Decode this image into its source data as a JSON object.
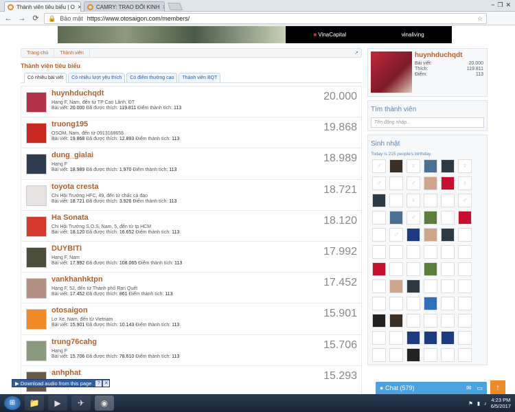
{
  "browser": {
    "tabs": [
      {
        "title": "Thành viên tiêu biểu | O",
        "active": true
      },
      {
        "title": "CAMRY: TRAO ĐỔI KINH",
        "active": false
      }
    ],
    "nav": {
      "back": "←",
      "forward": "→",
      "reload": "⟳"
    },
    "address": {
      "secure_label": "Bảo mật",
      "url": "https://www.otosaigon.com/members/",
      "star": "☆"
    },
    "window_buttons": [
      "−",
      "❐",
      "✕"
    ]
  },
  "banner": {
    "ad1": "VinaCapital",
    "ad2": "vinaliving"
  },
  "breadcrumb": [
    "Trang chủ",
    "Thành viên"
  ],
  "page_title": "Thành viên tiêu biểu",
  "tabs": [
    "Có nhiều bài viết",
    "Có nhiều lượt yêu thích",
    "Có điểm thưởng cao",
    "Thành viên BQT"
  ],
  "members": [
    {
      "name": "huynhduchqdt",
      "line": "Hạng F, Nam, đến từ TP Cao Lãnh, ĐT",
      "posts": "20.000",
      "likes": "119.811",
      "points": "113",
      "score": "20.000",
      "avatar": "#b3344a"
    },
    {
      "name": "truong195",
      "line": "OSOM, Nam, đến từ 0913168658",
      "posts": "19.868",
      "likes": "12.893",
      "points": "113",
      "score": "19.868",
      "avatar": "#c8281f"
    },
    {
      "name": "dung_gialai",
      "line": "Hạng F",
      "posts": "18.989",
      "likes": "1.970",
      "points": "113",
      "score": "18.989",
      "avatar": "#2e3c52"
    },
    {
      "name": "toyota cresta",
      "line": "Chi Hội Trưởng HFC, 49, đến từ chấc cả đao",
      "posts": "18.721",
      "likes": "3.926",
      "points": "113",
      "score": "18.721",
      "avatar": "#e8e3e3"
    },
    {
      "name": "Ha Sonata",
      "line": "Chi Hội Trưởng S.O.S, Nam, 5, đến từ tp HCM",
      "posts": "18.120",
      "likes": "16.652",
      "points": "113",
      "score": "18.120",
      "avatar": "#d33a2c"
    },
    {
      "name": "DUYBITI",
      "line": "Hạng F, Nam",
      "posts": "17.992",
      "likes": "108.065",
      "points": "113",
      "score": "17.992",
      "avatar": "#4a4e3a"
    },
    {
      "name": "vankhanhktpn",
      "line": "Hạng F, 52, đến từ Thành phố Rạn Quết",
      "posts": "17.452",
      "likes": "861",
      "points": "113",
      "score": "17.452",
      "avatar": "#b49080"
    },
    {
      "name": "otosaigon",
      "line": "Lơ Xe, Nam, đến từ Vietnam",
      "posts": "15.901",
      "likes": "10.143",
      "points": "113",
      "score": "15.901",
      "avatar": "#f08a24"
    },
    {
      "name": "trung76cahg",
      "line": "Hạng F",
      "posts": "15.706",
      "likes": "78.610",
      "points": "113",
      "score": "15.706",
      "avatar": "#8a9a7c"
    },
    {
      "name": "anhphat",
      "line": "",
      "posts": "",
      "likes": "",
      "points": "",
      "score": "15.293",
      "avatar": "#6a5a4a"
    }
  ],
  "labels": {
    "posts": "Bài viết:",
    "likes": "Đã được thích:",
    "points": "Điểm thành tích:"
  },
  "visitor": {
    "name": "huynhduchqdt",
    "rows": [
      {
        "k": "Bài viết:",
        "v": "20.000"
      },
      {
        "k": "Thích:",
        "v": "119.811"
      },
      {
        "k": "Điểm:",
        "v": "113"
      }
    ]
  },
  "find_member": {
    "title": "Tìm thành viên",
    "placeholder": "Tên đăng nhập..."
  },
  "birthday": {
    "title": "Sinh nhật",
    "subtitle": "Today is 215 people's birthday."
  },
  "birthday_cells": [
    "♂",
    "c1",
    "♀",
    "c2",
    "c4",
    "♀",
    "♂",
    "?",
    "♂",
    "c3",
    "c5",
    "♀",
    "c4",
    "?",
    "♀",
    "?",
    "?",
    "♂",
    "?",
    "c2",
    "♂",
    "c6",
    "?",
    "c5",
    "?",
    "♂",
    "c8",
    "c3",
    "c4",
    "?",
    "?",
    "?",
    "?",
    "?",
    "?",
    "?",
    "c5",
    "?",
    "?",
    "c6",
    "?",
    "?",
    "?",
    "c3",
    "c4",
    "?",
    "?",
    "?",
    "?",
    "?",
    "?",
    "c7",
    "?",
    "?",
    "c9",
    "c1",
    "?",
    "?",
    "?",
    "?",
    "?",
    "?",
    "c8",
    "c8",
    "c8",
    "?",
    "?",
    "?",
    "c9",
    "?",
    "?",
    "?"
  ],
  "download_bar": {
    "label": "Download audio from this page",
    "icons": [
      "?",
      "✕"
    ]
  },
  "chat": {
    "label": "Chat",
    "count": "(579)"
  },
  "scroll_up": "↑",
  "taskbar": {
    "time": "4:23 PM",
    "date": "6/5/2017"
  }
}
